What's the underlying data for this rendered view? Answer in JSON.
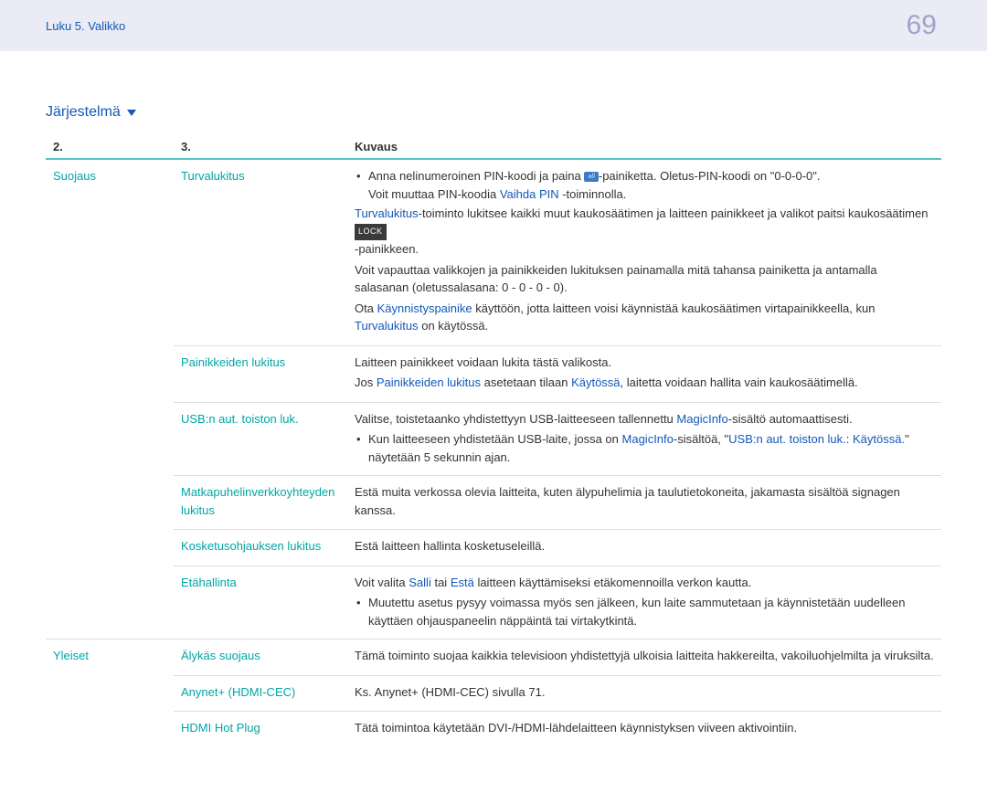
{
  "header": {
    "breadcrumb": "Luku 5. Valikko",
    "page_number": "69"
  },
  "section": {
    "title": "Järjestelmä"
  },
  "table": {
    "headers": {
      "col1": "2.",
      "col2": "3.",
      "col3": "Kuvaus"
    },
    "rows": [
      {
        "cat": "Suojaus",
        "sub": "Turvalukitus",
        "bullet1_a": "Anna nelinumeroinen PIN-koodi ja paina ",
        "bullet1_icon": "⏎",
        "bullet1_b": "-painiketta. Oletus-PIN-koodi on \"0-0-0-0\".",
        "bullet1_sub_a": "Voit muuttaa PIN-koodia ",
        "bullet1_sub_link": "Vaihda PIN",
        "bullet1_sub_b": " -toiminnolla.",
        "p2_link": "Turvalukitus",
        "p2_text": "-toiminto lukitsee kaikki muut kaukosäätimen ja laitteen painikkeet ja valikot paitsi kaukosäätimen ",
        "p2_badge": "LOCK",
        "p2_after": "-painikkeen.",
        "p3": "Voit vapauttaa valikkojen ja painikkeiden lukituksen painamalla mitä tahansa painiketta ja antamalla salasanan (oletussalasana: 0 - 0 - 0 - 0).",
        "p4_a": "Ota ",
        "p4_link1": "Käynnistyspainike",
        "p4_b": " käyttöön, jotta laitteen voisi käynnistää kaukosäätimen virtapainikkeella, kun ",
        "p4_link2": "Turvalukitus",
        "p4_c": " on käytössä."
      },
      {
        "sub": "Painikkeiden lukitus",
        "p1": "Laitteen painikkeet voidaan lukita tästä valikosta.",
        "p2_a": "Jos ",
        "p2_link1": "Painikkeiden lukitus",
        "p2_b": " asetetaan tilaan ",
        "p2_link2": "Käytössä",
        "p2_c": ", laitetta voidaan hallita vain kaukosäätimellä."
      },
      {
        "sub": "USB:n aut. toiston luk.",
        "p1_a": "Valitse, toistetaanko yhdistettyyn USB-laitteeseen tallennettu ",
        "p1_link": "MagicInfo",
        "p1_b": "-sisältö automaattisesti.",
        "bullet_a": "Kun laitteeseen yhdistetään USB-laite, jossa on ",
        "bullet_link1": "MagicInfo",
        "bullet_b": "-sisältöä, \"",
        "bullet_link2": "USB:n aut. toiston luk.",
        "bullet_c": ": ",
        "bullet_link3": "Käytössä.",
        "bullet_d": "\" näytetään 5 sekunnin ajan."
      },
      {
        "sub": "Matkapuhelinverkkoyhteyden lukitus",
        "p1": "Estä muita verkossa olevia laitteita, kuten älypuhelimia ja taulutietokoneita, jakamasta sisältöä signagen kanssa."
      },
      {
        "sub": "Kosketusohjauksen lukitus",
        "p1": "Estä laitteen hallinta kosketuseleillä."
      },
      {
        "sub": "Etähallinta",
        "p1_a": "Voit valita ",
        "p1_link1": "Salli",
        "p1_b": " tai ",
        "p1_link2": "Estä",
        "p1_c": " laitteen käyttämiseksi etäkomennoilla verkon kautta.",
        "bullet": "Muutettu asetus pysyy voimassa myös sen jälkeen, kun laite sammutetaan ja käynnistetään uudelleen käyttäen ohjauspaneelin näppäintä tai virtakytkintä."
      },
      {
        "cat": "Yleiset",
        "sub": "Älykäs suojaus",
        "p1": "Tämä toiminto suojaa kaikkia televisioon yhdistettyjä ulkoisia laitteita hakkereilta, vakoiluohjelmilta ja viruksilta."
      },
      {
        "sub": "Anynet+ (HDMI-CEC)",
        "p1": "Ks. Anynet+ (HDMI-CEC) sivulla 71."
      },
      {
        "sub": "HDMI Hot Plug",
        "p1": "Tätä toimintoa käytetään DVI-/HDMI-lähdelaitteen käynnistyksen viiveen aktivointiin."
      }
    ]
  }
}
